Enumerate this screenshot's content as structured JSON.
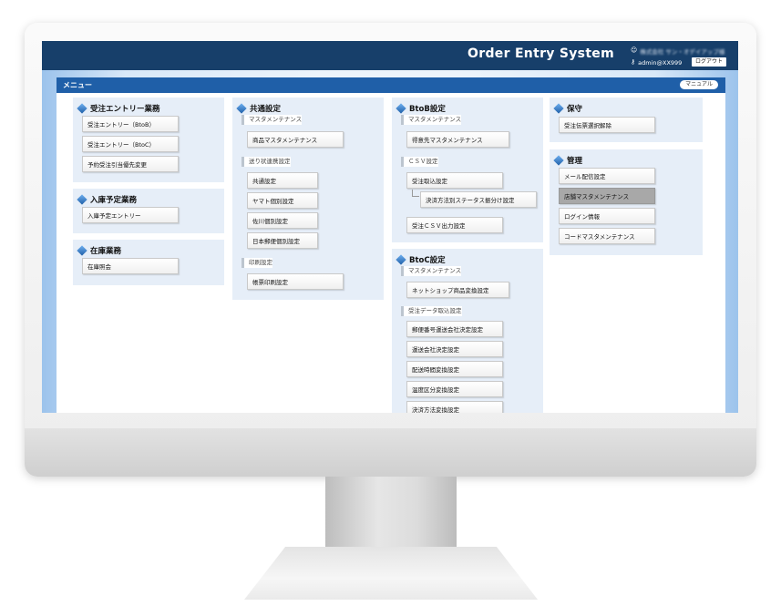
{
  "app": {
    "title": "Order Entry System",
    "user_icon": "user-circle-icon",
    "company_blurred": "株式会社 サン・オデイアップ様",
    "key_icon": "key-icon",
    "user_id": "admin@XX999",
    "logout_label": "ログアウト"
  },
  "menu": {
    "title": "メニュー",
    "manual_label": "マニュアル"
  },
  "sections": {
    "order_entry": {
      "title": "受注エントリー業務",
      "items": [
        "受注エントリー（BtoB）",
        "受注エントリー（BtoC）",
        "予約受注引当優先変更"
      ]
    },
    "receiving": {
      "title": "入庫予定業務",
      "items": [
        "入庫予定エントリー"
      ]
    },
    "inventory": {
      "title": "在庫業務",
      "items": [
        "在庫照会"
      ]
    },
    "common": {
      "title": "共通設定",
      "group1": "マスタメンテナンス",
      "master_items": [
        "商品マスタメンテナンス"
      ],
      "group2": "送り状連携設定",
      "shipping_items": [
        "共通設定",
        "ヤマト個別設定",
        "佐川個別設定",
        "日本郵便個別設定"
      ],
      "group3": "印刷設定",
      "print_items": [
        "帳票印刷設定"
      ]
    },
    "btob": {
      "title": "BtoB設定",
      "group1": "マスタメンテナンス",
      "master_items": [
        "得意先マスタメンテナンス"
      ],
      "group2": "ＣＳＶ設定",
      "csv_import": "受注取込設定",
      "csv_sub": "決済方法別ステータス振分け設定",
      "csv_output": "受注ＣＳＶ出力設定"
    },
    "btoc": {
      "title": "BtoC設定",
      "group1": "マスタメンテナンス",
      "master_items": [
        "ネットショップ商品変換設定"
      ],
      "group2": "受注データ取込設定",
      "import_items": [
        "郵便番号運送会社決定設定",
        "運送会社決定設定",
        "配送時間変換設定",
        "温度区分変換設定",
        "決済方法変換設定"
      ]
    },
    "maintenance": {
      "title": "保守",
      "items": [
        "受注伝票選択解除"
      ]
    },
    "admin": {
      "title": "管理",
      "items": [
        "メール配信設定",
        "店舗マスタメンテナンス",
        "ログイン情報",
        "コードマスタメンテナンス"
      ],
      "active_index": 1
    }
  },
  "colors": {
    "header": "#173f6a",
    "menu_bar": "#1f5fa8",
    "section_bg": "#e6eef8",
    "active_button": "#a8a8a8"
  }
}
